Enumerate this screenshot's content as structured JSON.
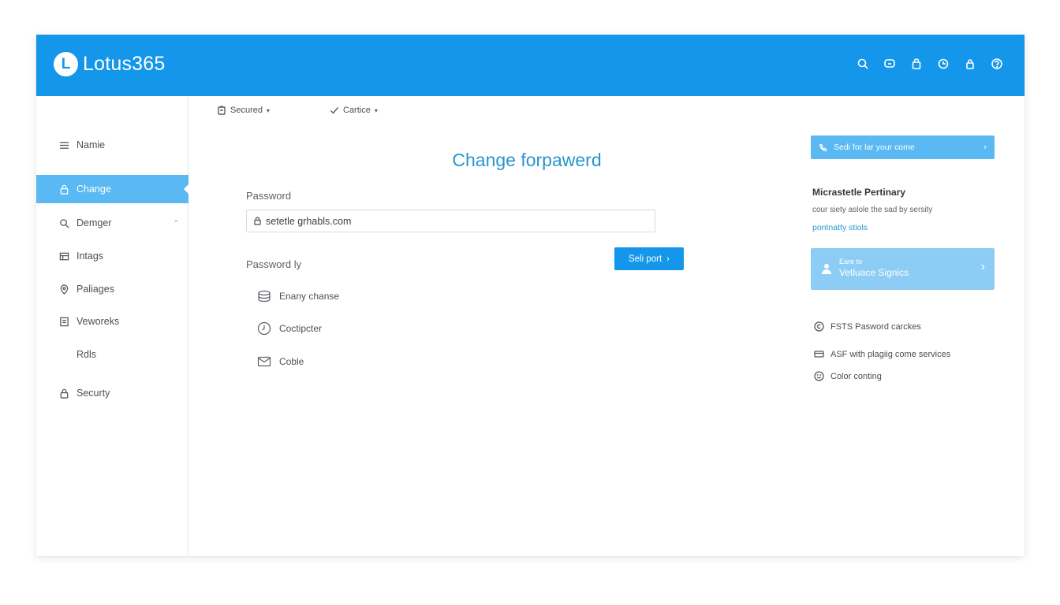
{
  "app": {
    "logo_letter": "L",
    "name": "Lotus365"
  },
  "header": {
    "icons": [
      "search-icon",
      "chat-icon",
      "lock-icon",
      "clock-icon",
      "lock-icon",
      "help-icon"
    ]
  },
  "sidebar": {
    "items": [
      {
        "label": "Namie",
        "icon": "menu-icon"
      },
      {
        "label": "Change",
        "icon": "lock-icon"
      },
      {
        "label": "Demger",
        "icon": "search-icon"
      },
      {
        "label": "Intags",
        "icon": "image-icon"
      },
      {
        "label": "Paliages",
        "icon": "location-icon"
      },
      {
        "label": "Veworeks",
        "icon": "document-icon"
      },
      {
        "label": "Rdls",
        "icon": ""
      },
      {
        "label": "Securty",
        "icon": "lock-icon"
      }
    ],
    "caret": "⌃"
  },
  "toolbar": {
    "secured_label": "Secured",
    "cartice_label": "Cartice"
  },
  "main": {
    "title": "Change forpawerd",
    "password_label": "Password",
    "password_value": "setetle grhabls.com",
    "password_by_label": "Password ly",
    "primary_button": "Seli port",
    "options": [
      {
        "label": "Enany chanse",
        "icon": "database-icon"
      },
      {
        "label": "Coctipcter",
        "icon": "clock-icon"
      },
      {
        "label": "Coble",
        "icon": "mail-icon"
      }
    ]
  },
  "right_panel": {
    "promo_top": "Sedi for lar your come",
    "title": "Micrastetle Pertinary",
    "description": "cour siety aslole the sad by sersity",
    "link": "pontnatty stiols",
    "promo_card": {
      "small": "Eare to",
      "big": "Vetluace Signics"
    },
    "features": [
      {
        "label": "FSTS Pasword carckes",
        "icon": "copyright-icon"
      },
      {
        "label": "ASF with plagiig come services",
        "icon": "card-icon"
      },
      {
        "label": "Color conting",
        "icon": "smile-icon"
      }
    ]
  },
  "colors": {
    "brand": "#1496ea",
    "active": "#5ab8f2",
    "accent_text": "#2996cc"
  }
}
